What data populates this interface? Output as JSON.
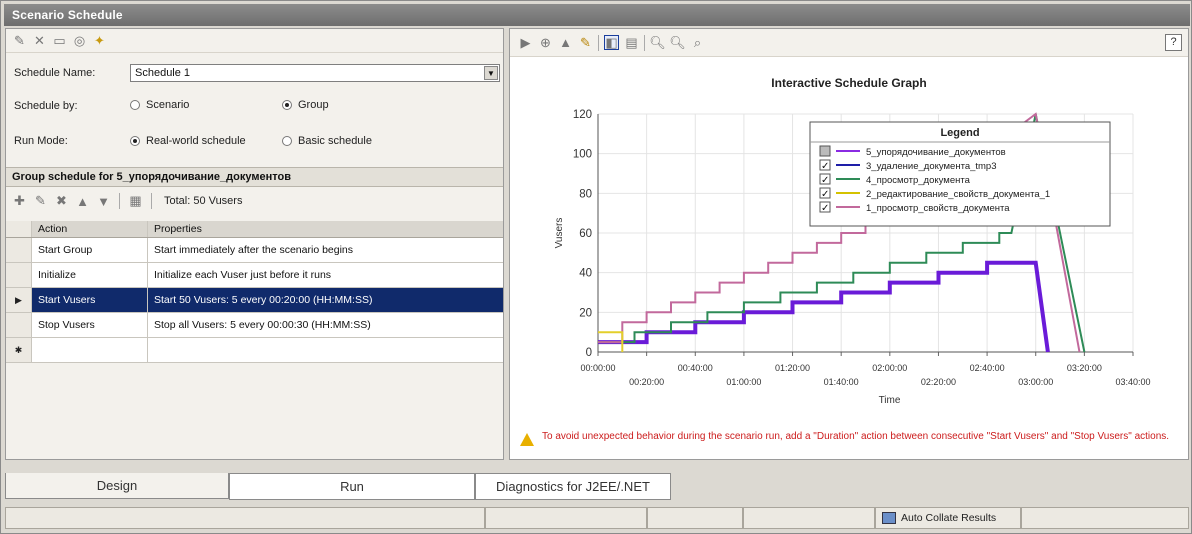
{
  "window": {
    "title": "Scenario Schedule"
  },
  "schedule": {
    "name_label": "Schedule Name:",
    "name_value": "Schedule 1",
    "by_label": "Schedule by:",
    "by_options": [
      "Scenario",
      "Group"
    ],
    "by_selected": "Group",
    "mode_label": "Run Mode:",
    "mode_options": [
      "Real-world schedule",
      "Basic schedule"
    ],
    "mode_selected": "Real-world schedule"
  },
  "group_schedule": {
    "header": "Group schedule for 5_упорядочивание_документов",
    "total": "Total: 50 Vusers",
    "columns": [
      "Action",
      "Properties"
    ],
    "rows": [
      {
        "action": "Start Group",
        "properties": "Start immediately after the scenario begins"
      },
      {
        "action": "Initialize",
        "properties": "Initialize each Vuser just before it runs"
      },
      {
        "action": "Start  Vusers",
        "properties": "Start 50 Vusers: 5 every 00:20:00 (HH:MM:SS)"
      },
      {
        "action": "Stop Vusers",
        "properties": "Stop all Vusers: 5 every 00:00:30 (HH:MM:SS)"
      }
    ],
    "selected_row": 2,
    "new_row_marker": "✱"
  },
  "graph_toolbar_help": "?",
  "chart_data": {
    "type": "line",
    "title": "Interactive Schedule Graph",
    "xlabel": "Time",
    "ylabel": "Vusers",
    "ylim": [
      0,
      120
    ],
    "xlim": [
      "00:00:00",
      "03:40:00"
    ],
    "grid": true,
    "y_ticks": [
      "0",
      "20",
      "40",
      "60",
      "80",
      "100",
      "120"
    ],
    "x_ticks_upper": [
      "00:00:00",
      "00:40:00",
      "01:20:00",
      "02:00:00",
      "02:40:00",
      "03:20:00"
    ],
    "x_ticks_lower": [
      "00:20:00",
      "01:00:00",
      "01:40:00",
      "02:20:00",
      "03:00:00",
      "03:40:00"
    ],
    "legend": {
      "title": "Legend",
      "placement": "top-right",
      "items": [
        {
          "name": "5_упорядочивание_документов",
          "color": "#8a2be2",
          "checked": false
        },
        {
          "name": "3_удаление_документа_tmp3",
          "color": "#1e1ea8",
          "checked": true
        },
        {
          "name": "4_просмотр_документа",
          "color": "#2e8b57",
          "checked": true
        },
        {
          "name": "2_редактирование_свойств_документа_1",
          "color": "#d4c200",
          "checked": true
        },
        {
          "name": "1_просмотр_свойств_документа",
          "color": "#c2699c",
          "checked": true
        }
      ]
    },
    "series": [
      {
        "name": "5_упорядочивание_документов",
        "color": "#6a1bd8",
        "points": [
          [
            "00:00:00",
            5
          ],
          [
            "00:20:00",
            5
          ],
          [
            "00:20:00",
            10
          ],
          [
            "00:40:00",
            10
          ],
          [
            "00:40:00",
            15
          ],
          [
            "01:00:00",
            15
          ],
          [
            "01:00:00",
            20
          ],
          [
            "01:20:00",
            20
          ],
          [
            "01:20:00",
            25
          ],
          [
            "01:40:00",
            25
          ],
          [
            "01:40:00",
            30
          ],
          [
            "02:00:00",
            30
          ],
          [
            "02:00:00",
            35
          ],
          [
            "02:20:00",
            35
          ],
          [
            "02:20:00",
            40
          ],
          [
            "02:40:00",
            40
          ],
          [
            "02:40:00",
            45
          ],
          [
            "03:00:00",
            45
          ],
          [
            "03:05:00",
            0
          ]
        ]
      },
      {
        "name": "4_просмотр_документа",
        "color": "#2e8b57",
        "points": [
          [
            "00:00:00",
            5
          ],
          [
            "00:15:00",
            5
          ],
          [
            "00:15:00",
            10
          ],
          [
            "00:30:00",
            10
          ],
          [
            "00:30:00",
            15
          ],
          [
            "00:45:00",
            15
          ],
          [
            "00:45:00",
            20
          ],
          [
            "01:00:00",
            20
          ],
          [
            "01:00:00",
            25
          ],
          [
            "01:15:00",
            25
          ],
          [
            "01:15:00",
            30
          ],
          [
            "01:30:00",
            30
          ],
          [
            "01:30:00",
            35
          ],
          [
            "01:45:00",
            35
          ],
          [
            "01:45:00",
            40
          ],
          [
            "02:00:00",
            40
          ],
          [
            "02:00:00",
            45
          ],
          [
            "02:15:00",
            45
          ],
          [
            "02:15:00",
            50
          ],
          [
            "02:30:00",
            50
          ],
          [
            "02:30:00",
            55
          ],
          [
            "02:45:00",
            55
          ],
          [
            "02:45:00",
            60
          ],
          [
            "02:50:00",
            60
          ],
          [
            "03:00:00",
            120
          ],
          [
            "03:20:00",
            0
          ]
        ]
      },
      {
        "name": "1_просмотр_свойств_документа",
        "color": "#c2699c",
        "points": [
          [
            "00:00:00",
            5
          ],
          [
            "00:10:00",
            5
          ],
          [
            "00:10:00",
            15
          ],
          [
            "00:20:00",
            15
          ],
          [
            "00:20:00",
            20
          ],
          [
            "00:30:00",
            20
          ],
          [
            "00:30:00",
            25
          ],
          [
            "00:40:00",
            25
          ],
          [
            "00:40:00",
            30
          ],
          [
            "00:50:00",
            30
          ],
          [
            "00:50:00",
            35
          ],
          [
            "01:00:00",
            35
          ],
          [
            "01:00:00",
            40
          ],
          [
            "01:10:00",
            40
          ],
          [
            "01:10:00",
            45
          ],
          [
            "01:20:00",
            45
          ],
          [
            "01:20:00",
            50
          ],
          [
            "01:30:00",
            50
          ],
          [
            "01:30:00",
            55
          ],
          [
            "01:40:00",
            55
          ],
          [
            "01:40:00",
            60
          ],
          [
            "01:50:00",
            60
          ],
          [
            "01:50:00",
            65
          ],
          [
            "02:00:00",
            65
          ],
          [
            "03:00:00",
            120
          ],
          [
            "03:18:00",
            0
          ]
        ]
      },
      {
        "name": "2_редактирование_свойств_документа_1",
        "color": "#e3cf2a",
        "points": [
          [
            "00:00:00",
            10
          ],
          [
            "00:10:00",
            10
          ],
          [
            "00:10:00",
            0
          ]
        ]
      }
    ]
  },
  "warning": "To avoid unexpected behavior during the scenario run, add a \"Duration\" action between consecutive \"Start Vusers\" and \"Stop Vusers\" actions.",
  "tabs": [
    "Design",
    "Run",
    "Diagnostics for J2EE/.NET"
  ],
  "active_tab": "Design",
  "status": {
    "auto_collate": "Auto Collate Results"
  }
}
